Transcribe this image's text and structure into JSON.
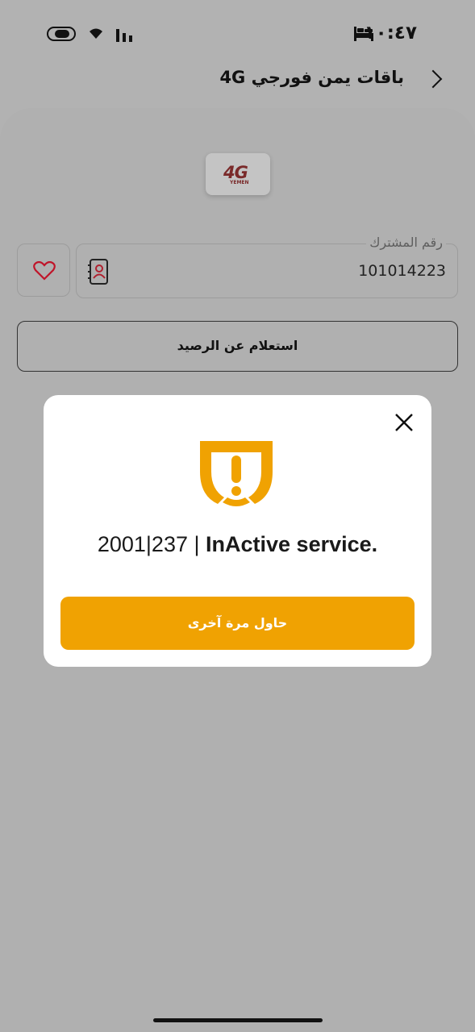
{
  "status_bar": {
    "time": "١٠:٤٧"
  },
  "header": {
    "title": "باقات يمن فورجي 4G"
  },
  "logo": {
    "text": "4G",
    "sub": "YEMEN"
  },
  "subscriber": {
    "label": "رقم المشترك",
    "value": "101014223"
  },
  "actions": {
    "check_balance_label": "استعلام عن الرصيد"
  },
  "dialog": {
    "code": "2001|237 |",
    "message": "InActive service.",
    "retry_label": "حاول مرة آخرى"
  },
  "colors": {
    "accent": "#f0a202",
    "heart": "#c0152a"
  }
}
